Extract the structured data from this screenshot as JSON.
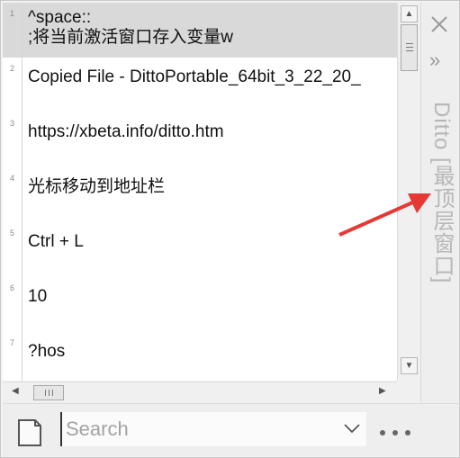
{
  "clips": [
    {
      "num": "1",
      "line1": "^space::",
      "line2": ";将当前激活窗口存入变量w",
      "selected": true
    },
    {
      "num": "2",
      "line1": "Copied File - DittoPortable_64bit_3_22_20_",
      "line2": "",
      "selected": false
    },
    {
      "num": "3",
      "line1": "https://xbeta.info/ditto.htm",
      "line2": "",
      "selected": false
    },
    {
      "num": "4",
      "line1": "光标移动到地址栏",
      "line2": "",
      "selected": false
    },
    {
      "num": "5",
      "line1": "Ctrl + L",
      "line2": "",
      "selected": false
    },
    {
      "num": "6",
      "line1": "10",
      "line2": "",
      "selected": false
    },
    {
      "num": "7",
      "line1": "?hos",
      "line2": "",
      "selected": false
    }
  ],
  "sidepanel": {
    "title": "Ditto [最顶层窗口]",
    "close_icon": "close-icon",
    "expand_icon": "double-chevron-right-icon"
  },
  "search": {
    "placeholder": "Search",
    "value": ""
  },
  "colors": {
    "selected_row": "#d9d9d9",
    "annotation": "#e53935",
    "side_text": "#b7b7b7"
  }
}
